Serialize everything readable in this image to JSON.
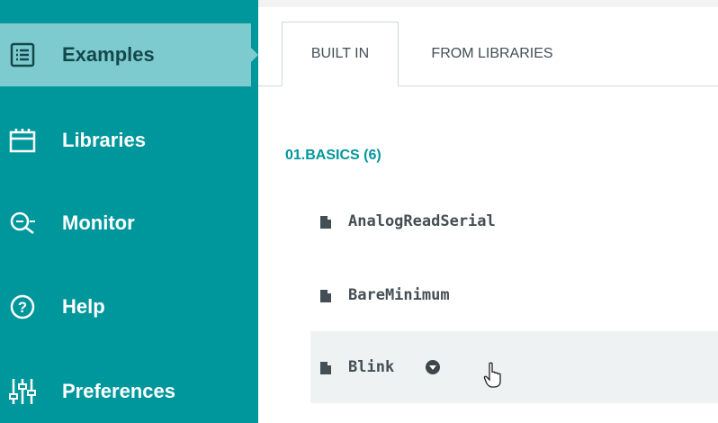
{
  "sidebar": {
    "items": [
      {
        "label": "Examples",
        "icon": "list-icon",
        "active": true
      },
      {
        "label": "Libraries",
        "icon": "library-icon",
        "active": false
      },
      {
        "label": "Monitor",
        "icon": "monitor-icon",
        "active": false
      },
      {
        "label": "Help",
        "icon": "help-icon",
        "active": false
      },
      {
        "label": "Preferences",
        "icon": "preferences-icon",
        "active": false
      }
    ]
  },
  "tabs": [
    {
      "label": "BUILT IN",
      "selected": true
    },
    {
      "label": "FROM LIBRARIES",
      "selected": false
    }
  ],
  "section": {
    "title": "01.BASICS (6)"
  },
  "examples": [
    {
      "name": "AnalogReadSerial"
    },
    {
      "name": "BareMinimum"
    },
    {
      "name": "Blink"
    }
  ],
  "colors": {
    "accent": "#00979c",
    "active_item": "#7ecbcf",
    "text": "#434f54"
  }
}
